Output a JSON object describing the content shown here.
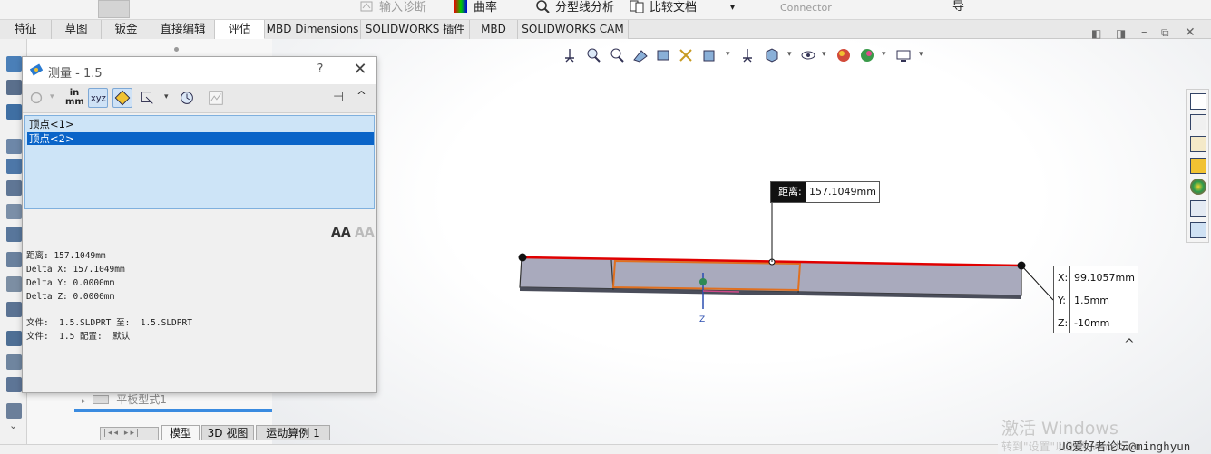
{
  "ribbon_commands": [
    {
      "label": "输入诊断",
      "icon": "import-diagnostics-icon",
      "dim": true
    },
    {
      "label": "曲率",
      "icon": "curvature-icon",
      "dim": false
    },
    {
      "label": "分型线分析",
      "icon": "parting-line-analysis-icon",
      "dim": false
    },
    {
      "label": "比较文档",
      "icon": "compare-documents-icon",
      "dim": false
    },
    {
      "label": "Connector",
      "icon": "",
      "dim": true
    },
    {
      "label": "导",
      "icon": "",
      "dim": false
    }
  ],
  "tabs": [
    "特征",
    "草图",
    "钣金",
    "直接编辑",
    "评估",
    "MBD Dimensions",
    "SOLIDWORKS 插件",
    "MBD",
    "SOLIDWORKS CAM"
  ],
  "active_tab": "评估",
  "measure_dialog": {
    "title": "测量 - 1.5",
    "help": "?",
    "close": "✕",
    "units_label_top": "in",
    "units_label_bottom": "mm",
    "selections": [
      "顶点<1>",
      "顶点<2>"
    ],
    "selected_index": 1,
    "results": [
      "距离: 157.1049mm",
      "Delta X: 157.1049mm",
      "Delta Y: 0.0000mm",
      "Delta Z: 0.0000mm"
    ],
    "files": [
      "文件:  1.5.SLDPRT 至:  1.5.SLDPRT",
      "文件:  1.5 配置:  默认"
    ]
  },
  "distance_callout": {
    "label": "距离:",
    "value": "157.1049mm"
  },
  "coordinate_callout": [
    {
      "axis": "X:",
      "value": "99.1057mm"
    },
    {
      "axis": "Y:",
      "value": "1.5mm"
    },
    {
      "axis": "Z:",
      "value": "-10mm"
    }
  ],
  "tree_item": "平板型式1",
  "bottom_tabs": [
    "模型",
    "3D 视图",
    "运动算例 1"
  ],
  "active_bottom_tab": "模型",
  "watermark": {
    "line1": "激活 Windows",
    "line2": "转到\"设置\"以激活 Windows"
  },
  "forum_credit": "UG爱好者论坛@minghyun",
  "colors": {
    "selection_blue": "#0a64c8",
    "edge_red": "#e00000",
    "part_face": "#a9aabd",
    "highlight_orange": "#e07020"
  }
}
